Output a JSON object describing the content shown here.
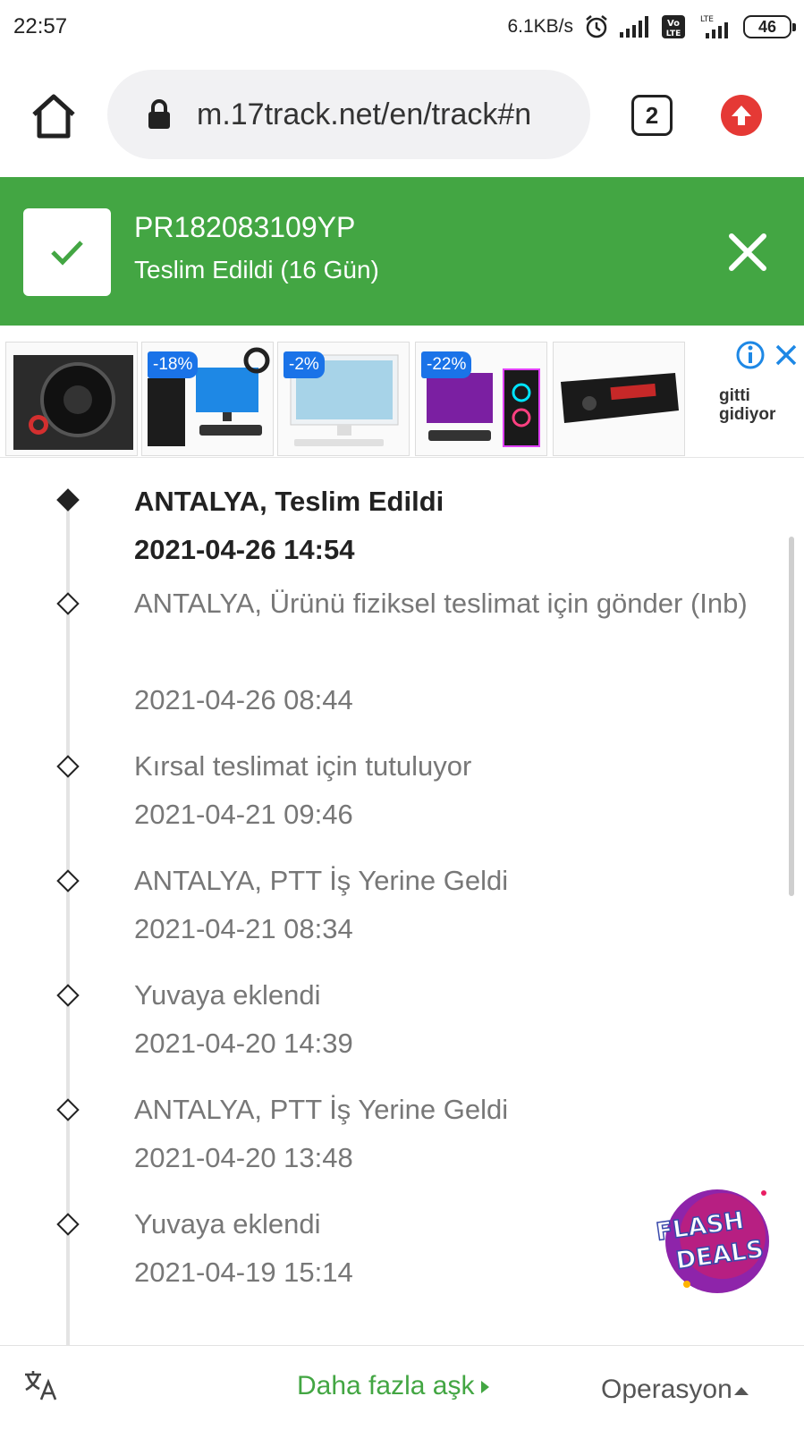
{
  "status_bar": {
    "time": "22:57",
    "net_speed": "6.1KB/s",
    "battery": "46",
    "volte_label": "Vo LTE",
    "lte_label": "LTE"
  },
  "browser": {
    "url": "m.17track.net/en/track#n",
    "tab_count": "2"
  },
  "tracking": {
    "number": "PR182083109YP",
    "status": "Teslim Edildi (16 Gün)",
    "accent_color": "#43a643"
  },
  "ad": {
    "discounts": [
      "-18%",
      "-2%",
      "-22%"
    ],
    "brand_line1": "gitti",
    "brand_line2": "gidiyor"
  },
  "events": [
    {
      "desc": "ANTALYA, Teslim Edildi",
      "time": "2021-04-26 14:54"
    },
    {
      "desc": "ANTALYA, Ürünü fiziksel teslimat için gönder (Inb)",
      "time": "2021-04-26 08:44"
    },
    {
      "desc": "Kırsal teslimat için tutuluyor",
      "time": "2021-04-21 09:46"
    },
    {
      "desc": "ANTALYA, PTT İş Yerine Geldi",
      "time": "2021-04-21 08:34"
    },
    {
      "desc": "Yuvaya eklendi",
      "time": "2021-04-20 14:39"
    },
    {
      "desc": "ANTALYA, PTT İş Yerine Geldi",
      "time": "2021-04-20 13:48"
    },
    {
      "desc": "Yuvaya eklendi",
      "time": "2021-04-19 15:14"
    }
  ],
  "flash_deals": {
    "line1": "FLASH",
    "line2": "DEALS"
  },
  "bottom_bar": {
    "more_label": "Daha fazla aşk",
    "ops_label": "Operasyon"
  }
}
